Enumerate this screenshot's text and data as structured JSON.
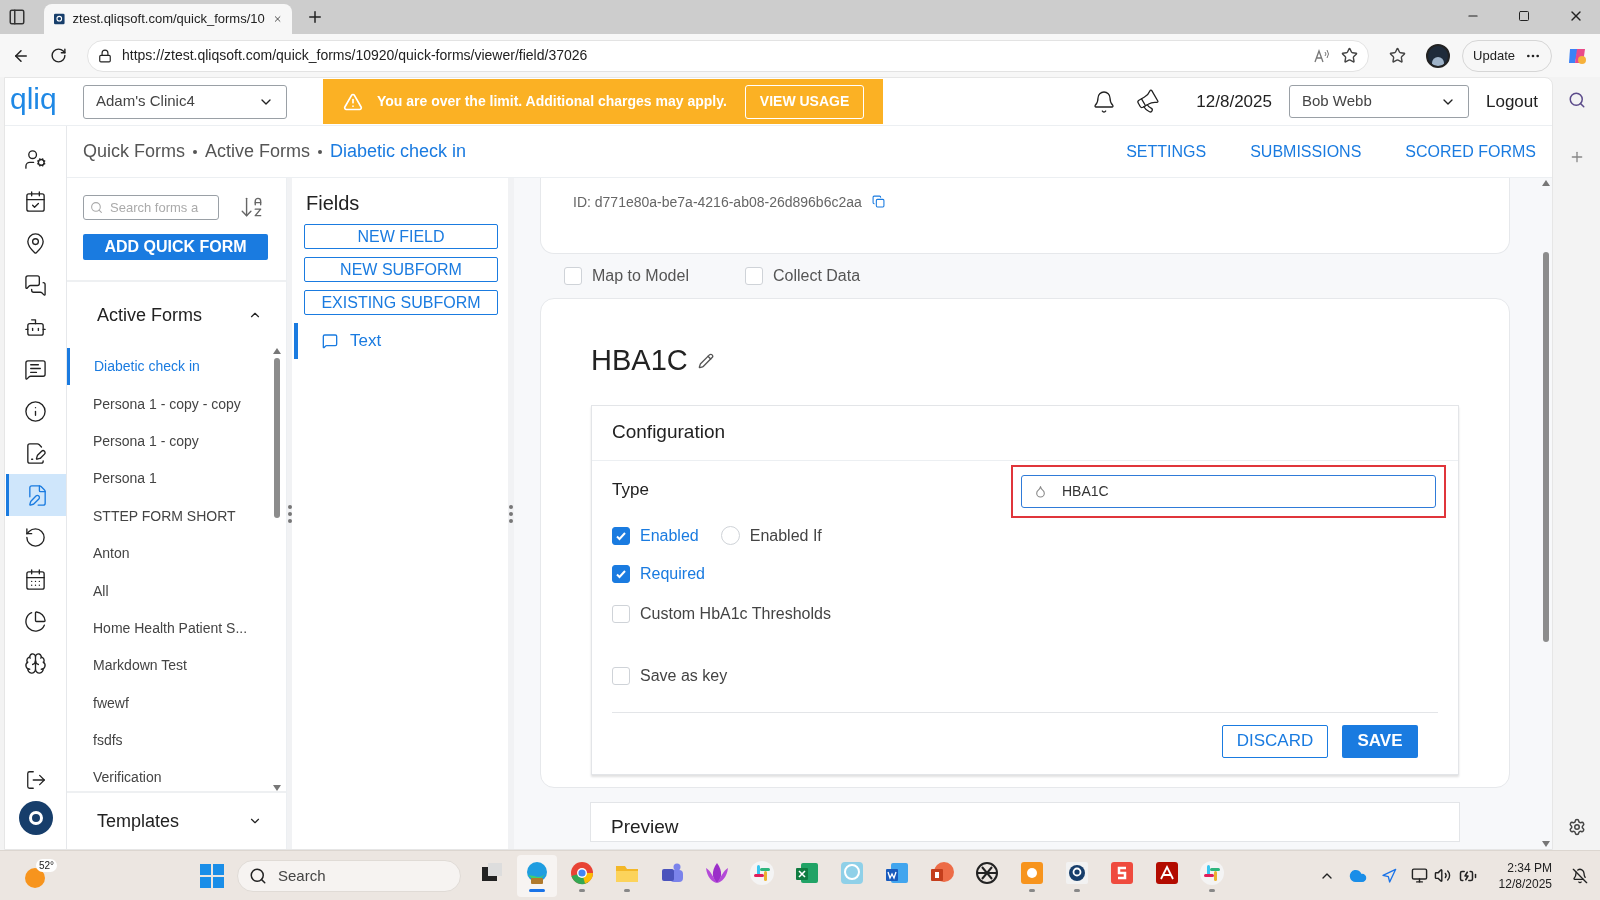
{
  "browser": {
    "tab_title": "ztest.qliqsoft.com/quick_forms/10",
    "url": "https://ztest.qliqsoft.com/quick_forms/10920/quick-forms/viewer/field/37026",
    "update_label": "Update"
  },
  "header": {
    "logo": "qliq",
    "clinic": "Adam's Clinic4",
    "banner": {
      "message": "You are over the limit. Additional charges may apply.",
      "action": "VIEW USAGE"
    },
    "date": "12/8/2025",
    "user": "Bob Webb",
    "logout": "Logout"
  },
  "breadcrumb": [
    {
      "label": "Quick Forms",
      "selected": false
    },
    {
      "label": "Active Forms",
      "selected": false
    },
    {
      "label": "Diabetic check in",
      "selected": true
    }
  ],
  "top_links": [
    "SETTINGS",
    "SUBMISSIONS",
    "SCORED FORMS"
  ],
  "rail": [
    {
      "kind": "users",
      "selected": false
    },
    {
      "kind": "calendar-check",
      "selected": false
    },
    {
      "kind": "pin",
      "selected": false
    },
    {
      "kind": "chat",
      "selected": false
    },
    {
      "kind": "bot",
      "selected": false
    },
    {
      "kind": "message",
      "selected": false
    },
    {
      "kind": "info",
      "selected": false
    },
    {
      "kind": "signature",
      "selected": false
    },
    {
      "kind": "form",
      "selected": true
    },
    {
      "kind": "replay",
      "selected": false
    },
    {
      "kind": "calendar",
      "selected": false
    },
    {
      "kind": "pie",
      "selected": false
    },
    {
      "kind": "brain",
      "selected": false
    }
  ],
  "forms_panel": {
    "search_placeholder": "Search forms a",
    "add_button": "ADD QUICK FORM",
    "active_title": "Active Forms",
    "active_expanded": true,
    "forms": [
      {
        "label": "Diabetic check in",
        "selected": true
      },
      {
        "label": "Persona 1 - copy - copy",
        "selected": false
      },
      {
        "label": "Persona 1 - copy",
        "selected": false
      },
      {
        "label": "Persona 1",
        "selected": false
      },
      {
        "label": "STTEP FORM SHORT",
        "selected": false
      },
      {
        "label": "Anton",
        "selected": false
      },
      {
        "label": "All",
        "selected": false
      },
      {
        "label": "Home Health Patient S...",
        "selected": false
      },
      {
        "label": "Markdown Test",
        "selected": false
      },
      {
        "label": "fwewf",
        "selected": false
      },
      {
        "label": "fsdfs",
        "selected": false
      },
      {
        "label": "Verification",
        "selected": false
      }
    ],
    "templates_title": "Templates",
    "templates_expanded": false
  },
  "fields_panel": {
    "title": "Fields",
    "buttons": [
      "NEW FIELD",
      "NEW SUBFORM",
      "EXISTING SUBFORM"
    ],
    "fields": [
      {
        "label": "Text",
        "selected": true
      }
    ]
  },
  "field_editor": {
    "id_text": "ID: d771e80a-be7a-4216-ab08-26d896b6c2aa",
    "options": [
      {
        "label": "Map to Model",
        "checked": false
      },
      {
        "label": "Collect Data",
        "checked": false
      }
    ],
    "title": "HBA1C",
    "config_title": "Configuration",
    "type_label": "Type",
    "type_value": "HBA1C",
    "highlighted": true,
    "settings": [
      {
        "kind": "checkbox",
        "label": "Enabled",
        "checked": true,
        "extra": {
          "kind": "radio",
          "label": "Enabled If",
          "checked": false
        }
      },
      {
        "kind": "checkbox",
        "label": "Required",
        "checked": true
      },
      {
        "kind": "checkbox",
        "label": "Custom HbA1c Thresholds",
        "checked": false
      },
      {
        "kind": "checkbox",
        "label": "Save as key",
        "checked": false
      }
    ],
    "discard": "DISCARD",
    "save": "SAVE",
    "preview_title": "Preview"
  },
  "taskbar": {
    "weather": "52°",
    "search_placeholder": "Search",
    "apps": [
      {
        "kind": "taskview",
        "running": false,
        "selected": false
      },
      {
        "kind": "edge",
        "running": true,
        "selected": true
      },
      {
        "kind": "chrome",
        "running": true,
        "selected": false
      },
      {
        "kind": "folder",
        "running": true,
        "selected": false
      },
      {
        "kind": "teams",
        "running": false,
        "selected": false
      },
      {
        "kind": "lotus",
        "running": false,
        "selected": false
      },
      {
        "kind": "slack",
        "running": false,
        "selected": false
      },
      {
        "kind": "excel",
        "running": false,
        "selected": false
      },
      {
        "kind": "head",
        "running": false,
        "selected": false
      },
      {
        "kind": "word",
        "running": false,
        "selected": false
      },
      {
        "kind": "powerpoint",
        "running": false,
        "selected": false
      },
      {
        "kind": "knot",
        "running": false,
        "selected": false
      },
      {
        "kind": "capture",
        "running": true,
        "selected": false
      },
      {
        "kind": "qliq",
        "running": true,
        "selected": false
      },
      {
        "kind": "snagit",
        "running": false,
        "selected": false
      },
      {
        "kind": "acrobat",
        "running": false,
        "selected": false
      },
      {
        "kind": "slack",
        "running": true,
        "selected": false
      }
    ],
    "time": "2:34 PM",
    "date": "12/8/2025"
  }
}
